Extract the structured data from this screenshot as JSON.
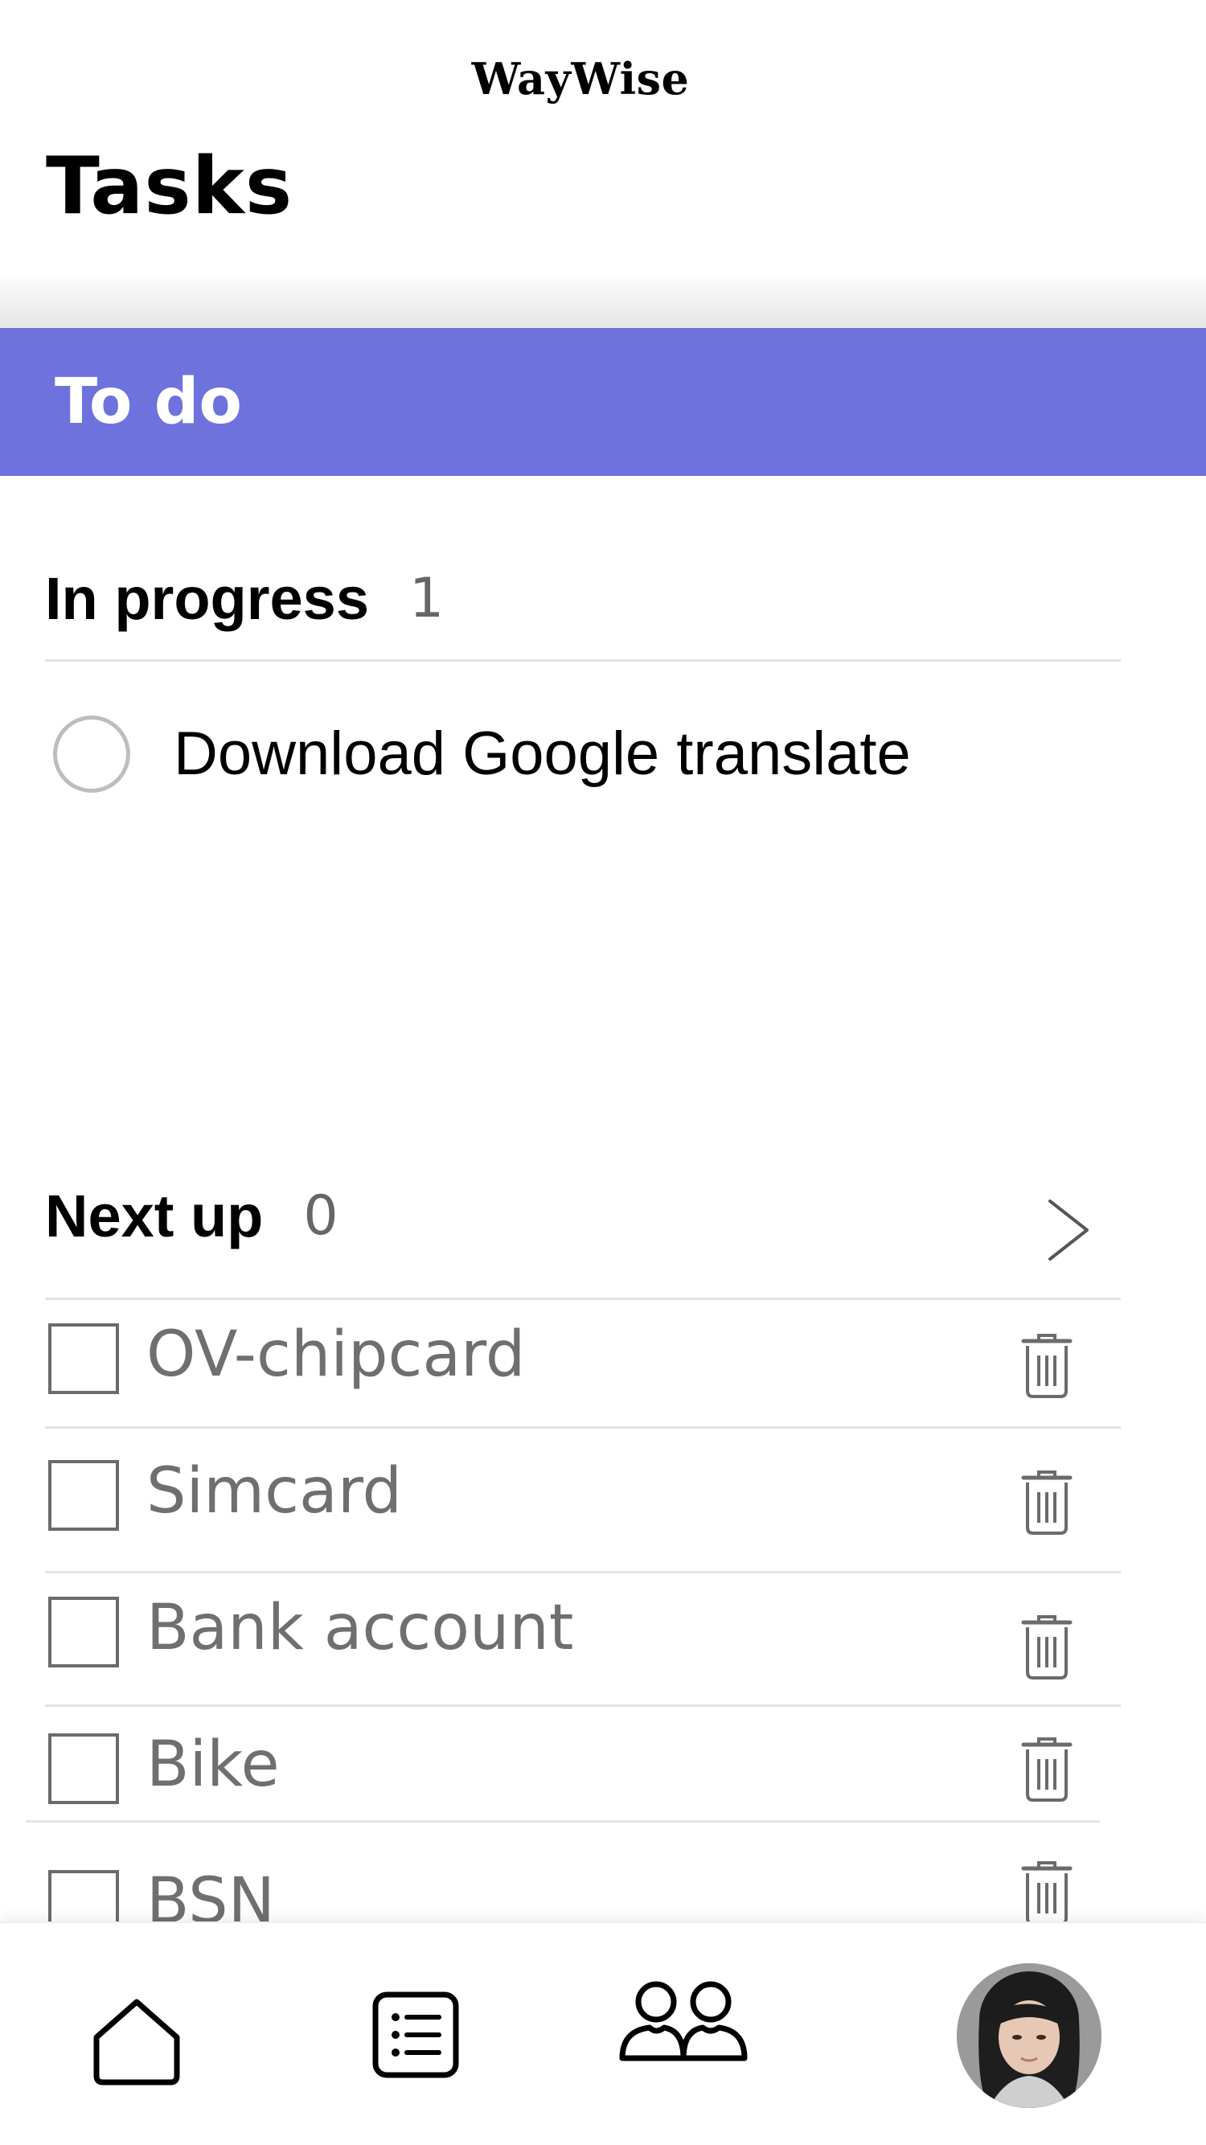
{
  "header": {
    "brand": "WayWise",
    "title": "Tasks"
  },
  "tab_bar": {
    "label": "To do",
    "color": "#6e72dc"
  },
  "in_progress": {
    "title": "In progress",
    "count": "1",
    "items": [
      {
        "label": "Download Google translate",
        "done": false
      }
    ]
  },
  "next_up": {
    "title": "Next up",
    "count": "0",
    "items": [
      {
        "label": "OV-chipcard",
        "checked": false
      },
      {
        "label": "Simcard",
        "checked": false
      },
      {
        "label": "Bank account",
        "checked": false
      },
      {
        "label": "Bike",
        "checked": false
      },
      {
        "label": "BSN",
        "checked": false
      }
    ]
  },
  "bottom_nav": {
    "items": [
      {
        "icon": "home-icon"
      },
      {
        "icon": "list-icon"
      },
      {
        "icon": "community-icon"
      },
      {
        "icon": "avatar"
      }
    ]
  }
}
